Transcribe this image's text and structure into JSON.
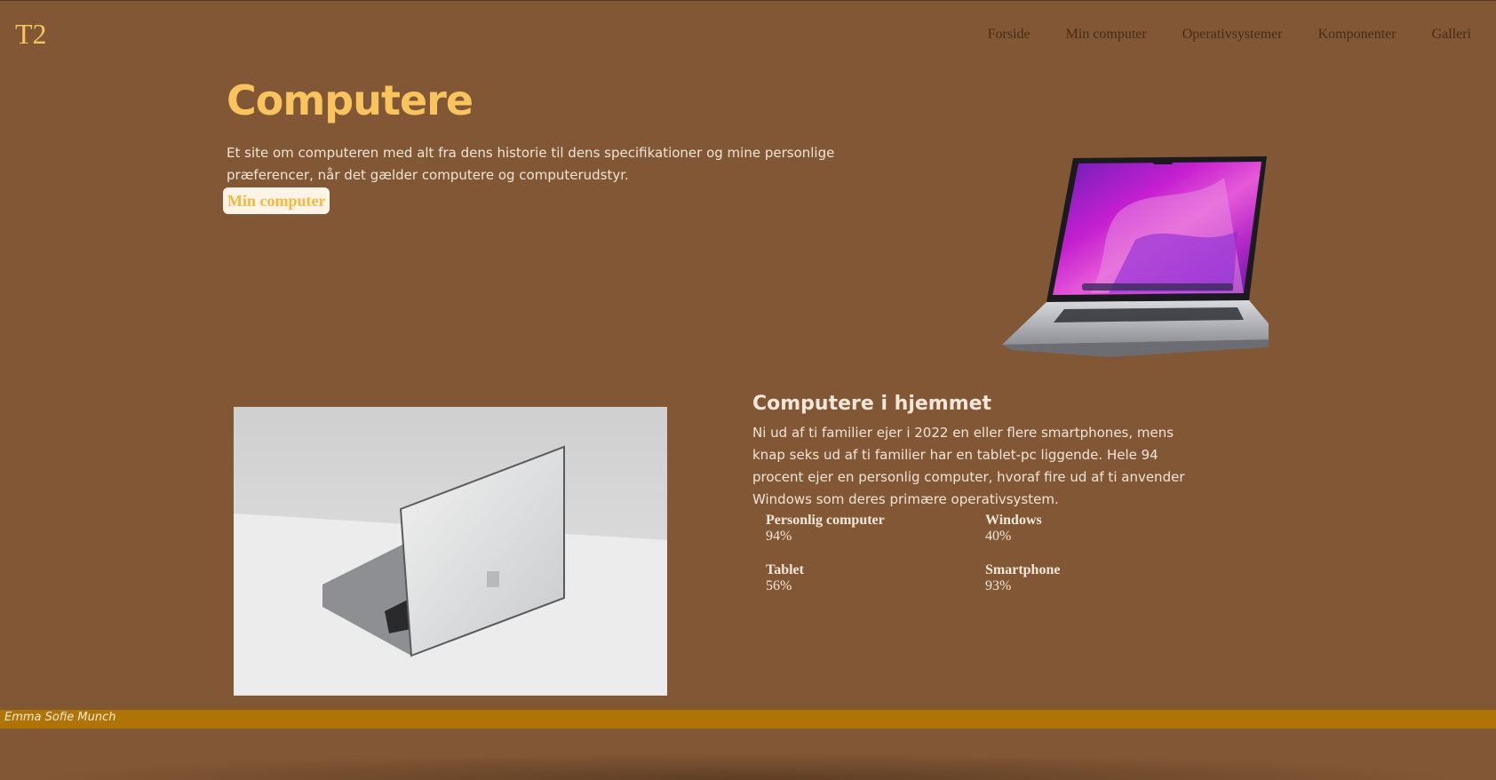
{
  "header": {
    "logo": "T2",
    "nav": [
      "Forside",
      "Min computer",
      "Operativsystemer",
      "Komponenter",
      "Galleri"
    ]
  },
  "hero": {
    "title": "Computere",
    "text": "Et site om computeren med alt fra dens historie til dens specifikationer og mine personlige præferencer, når det gælder computere og computerudstyr.",
    "button_label": "Min computer"
  },
  "section": {
    "title": "Computere i hjemmet",
    "text": "Ni ud af ti familier ejer i 2022 en eller flere smartphones, mens knap seks ud af ti familier har en tablet-pc liggende. Hele 94 procent ejer en personlig computer, hvoraf fire ud af ti anvender Windows som deres primære operativsystem.",
    "stats": [
      {
        "label": "Personlig computer",
        "value": "94%"
      },
      {
        "label": "Windows",
        "value": "40%"
      },
      {
        "label": "Tablet",
        "value": "56%"
      },
      {
        "label": "Smartphone",
        "value": "93%"
      }
    ]
  },
  "footer": {
    "author": "Emma Sofie Munch"
  },
  "colors": {
    "background": "#825735",
    "accent": "#f9c45d",
    "footer": "#b07406"
  }
}
